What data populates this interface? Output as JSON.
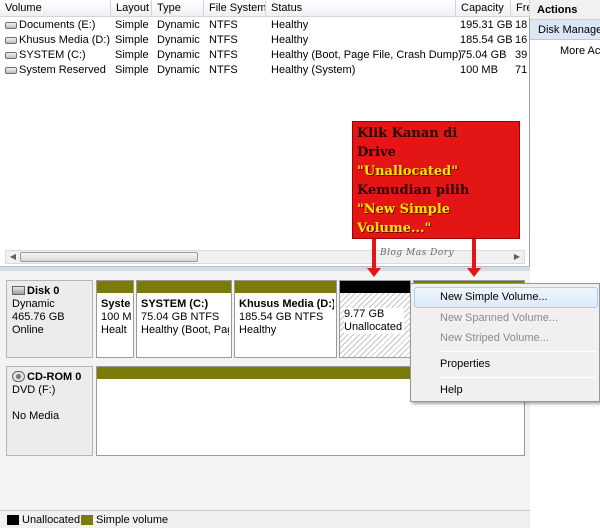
{
  "table": {
    "headers": [
      "Volume",
      "Layout",
      "Type",
      "File System",
      "Status",
      "Capacity",
      "Fre"
    ],
    "rows": [
      {
        "volume": "Documents (E:)",
        "layout": "Simple",
        "type": "Dynamic",
        "fs": "NTFS",
        "status": "Healthy",
        "capacity": "195.31 GB",
        "free": "18"
      },
      {
        "volume": "Khusus Media (D:)",
        "layout": "Simple",
        "type": "Dynamic",
        "fs": "NTFS",
        "status": "Healthy",
        "capacity": "185.54 GB",
        "free": "16"
      },
      {
        "volume": "SYSTEM (C:)",
        "layout": "Simple",
        "type": "Dynamic",
        "fs": "NTFS",
        "status": "Healthy (Boot, Page File, Crash Dump)",
        "capacity": "75.04 GB",
        "free": "39"
      },
      {
        "volume": "System Reserved",
        "layout": "Simple",
        "type": "Dynamic",
        "fs": "NTFS",
        "status": "Healthy (System)",
        "capacity": "100 MB",
        "free": "71"
      }
    ]
  },
  "disk0": {
    "name": "Disk 0",
    "type": "Dynamic",
    "size": "465.76 GB",
    "state": "Online",
    "partitions": [
      {
        "name": "Syste",
        "size": "100 M",
        "status": "Healt"
      },
      {
        "name": "SYSTEM  (C:)",
        "size": "75.04 GB NTFS",
        "status": "Healthy (Boot, Pag"
      },
      {
        "name": "Khusus Media  (D:)",
        "size": "185.54 GB NTFS",
        "status": "Healthy"
      },
      {
        "name": "",
        "size": "9.77 GB",
        "status": "Unallocated"
      }
    ]
  },
  "cdrom0": {
    "name": "CD-ROM 0",
    "drive": "DVD (F:)",
    "media": "No Media"
  },
  "legend": {
    "unallocated": "Unallocated",
    "simple": "Simple volume",
    "unallocated_color": "#000000",
    "simple_color": "#7b7a0c"
  },
  "actions": {
    "title": "Actions",
    "group": "Disk Management",
    "more": "More Actions"
  },
  "context_menu": {
    "items": [
      {
        "label": "New Simple Volume...",
        "enabled": true
      },
      {
        "label": "New Spanned Volume...",
        "enabled": false
      },
      {
        "label": "New Striped Volume...",
        "enabled": false
      },
      {
        "label": "Properties",
        "enabled": true
      },
      {
        "label": "Help",
        "enabled": true
      }
    ]
  },
  "annotation": {
    "line1": "Klik Kanan di",
    "line2": "Drive",
    "line3": "\"Unallocated\"",
    "line4": "Kemudian pilih",
    "line5": "\"New Simple",
    "line6": "Volume...\"",
    "watermark": "Blog Mas Dory"
  }
}
